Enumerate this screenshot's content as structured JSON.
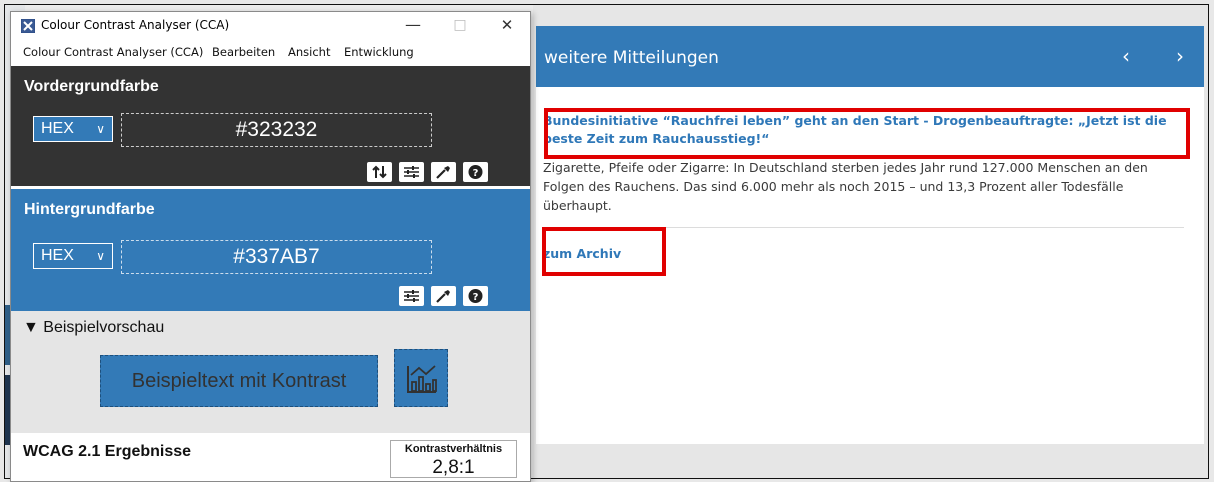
{
  "window": {
    "title": "Colour Contrast Analyser (CCA)",
    "controls": {
      "minimize": "—",
      "maximize": "□",
      "close": "✕"
    }
  },
  "menu": [
    "Colour Contrast Analyser (CCA)",
    "Bearbeiten",
    "Ansicht",
    "Entwicklung"
  ],
  "foreground": {
    "title": "Vordergrundfarbe",
    "format": "HEX",
    "hex": "#323232",
    "color": "#333333"
  },
  "background": {
    "title": "Hintergrundfarbe",
    "format": "HEX",
    "hex": "#337AB7",
    "color": "#337ab7"
  },
  "preview": {
    "title": "▼ Beispielvorschau",
    "sample_text": "Beispieltext mit Kontrast"
  },
  "wcag": {
    "title": "WCAG 2.1 Ergebnisse",
    "ratio_label": "Kontrastverhältnis",
    "ratio_value": "2,8:1"
  },
  "news": {
    "header": "weitere Mitteilungen",
    "prev": "‹",
    "next": "›",
    "headline": "Bundesinitiative “Rauchfrei leben” geht an den Start - Drogenbeauftragte: „Jetzt ist die beste Zeit zum Rauchausstieg!“",
    "body": "Zigarette, Pfeife oder Zigarre: In Deutschland sterben jedes Jahr rund 127.000 Menschen an den Folgen des Rauchens. Das sind 6.000 mehr als noch 2015 – und 13,3 Prozent aller Todesfälle überhaupt.",
    "archive": "zum Archiv",
    "accent": "#337ab7",
    "highlight": "#e00000"
  },
  "icons": {
    "swap": "swap-icon",
    "sliders": "sliders-icon",
    "eyedropper": "eyedropper-icon",
    "help": "help-icon",
    "chart": "chart-icon"
  }
}
